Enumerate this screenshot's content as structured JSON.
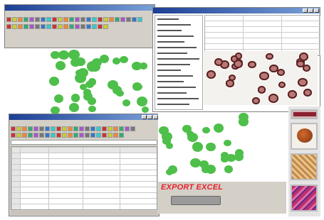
{
  "main_window": {
    "title": "",
    "menu": [
      "",
      "",
      "",
      "",
      "",
      "",
      "",
      ""
    ]
  },
  "stats_window": {
    "title": ""
  },
  "spreadsheet_window": {
    "title": "",
    "menu": [
      "",
      "",
      "",
      "",
      "",
      "",
      "",
      ""
    ],
    "columns": [
      "",
      "",
      "",
      ""
    ],
    "rows": [
      [
        "",
        "",
        "",
        ""
      ],
      [
        "",
        "",
        "",
        ""
      ],
      [
        "",
        "",
        "",
        ""
      ],
      [
        "",
        "",
        "",
        ""
      ],
      [
        "",
        "",
        "",
        ""
      ],
      [
        "",
        "",
        "",
        ""
      ],
      [
        "",
        "",
        "",
        ""
      ],
      [
        "",
        "",
        "",
        ""
      ],
      [
        "",
        "",
        "",
        ""
      ],
      [
        "",
        "",
        "",
        ""
      ]
    ]
  },
  "export_label": "EXPORT EXCEL",
  "export_button_label": "",
  "colors": {
    "accent_red": "#e8212b",
    "cell_green": "#4ebf4a",
    "cell_maroon": "#8b3a3a",
    "title_blue": "#1c3f94"
  },
  "icons": [
    "window-icon",
    "tool-icon",
    "thumbnail-image"
  ]
}
